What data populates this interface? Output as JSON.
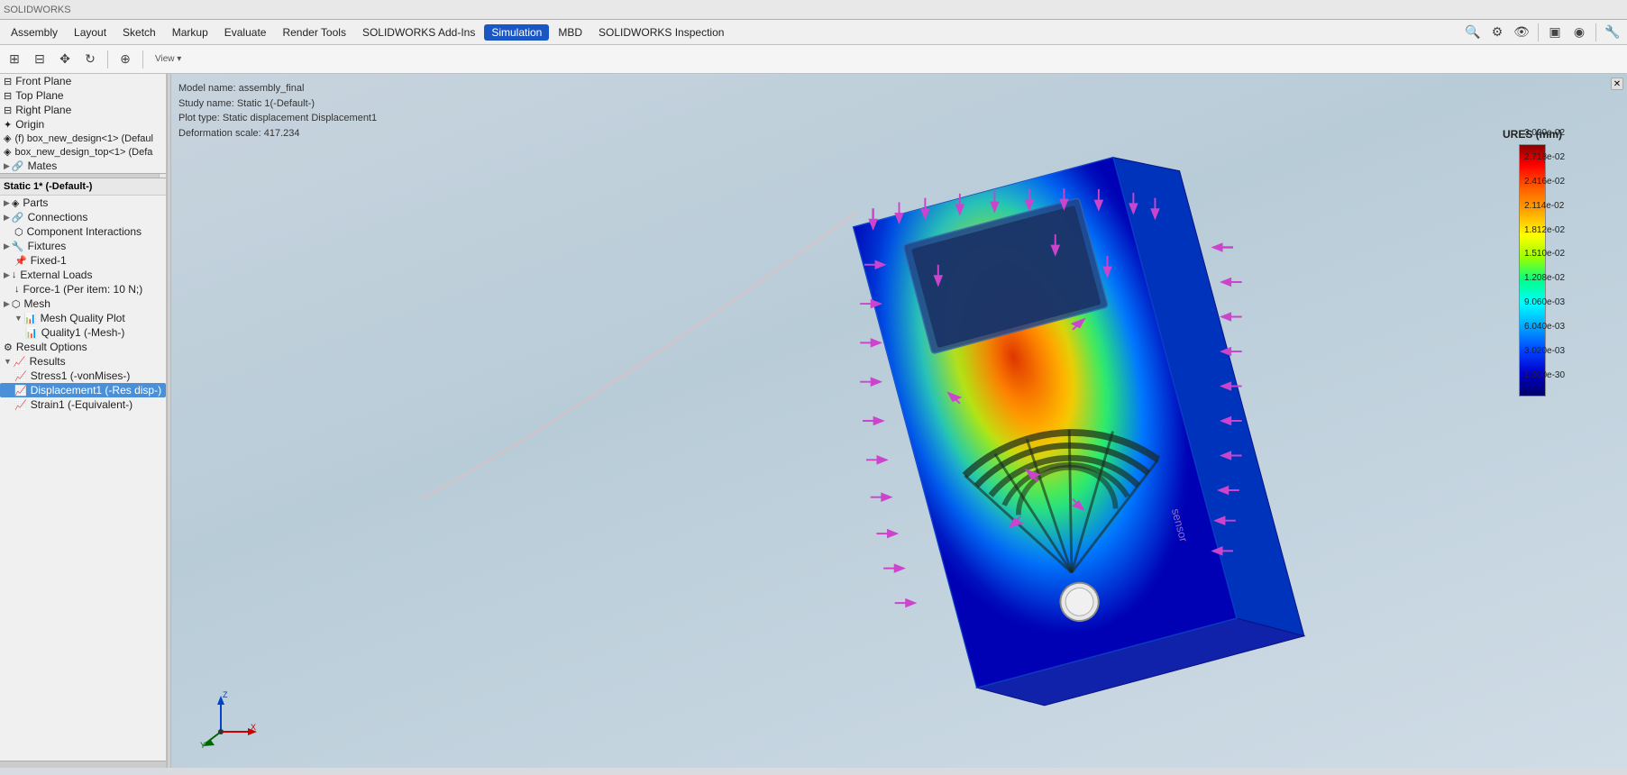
{
  "window": {
    "title": "SOLIDWORKS"
  },
  "toolbar": {
    "tab_assembly": "Assembly",
    "tab_layout": "Layout",
    "tab_sketch": "Sketch",
    "tab_markup": "Markup",
    "tab_evaluate": "Evaluate",
    "tab_render_tools": "Render Tools",
    "tab_solidworks_addins": "SOLIDWORKS Add-Ins",
    "tab_simulation": "Simulation",
    "tab_mbd": "MBD",
    "tab_solidworks_inspection": "SOLIDWORKS Inspection"
  },
  "model_info": {
    "model_name_label": "Model name: assembly_final",
    "study_name_label": "Study name: Static 1(-Default-)",
    "plot_type_label": "Plot type: Static displacement Displacement1",
    "deformation_scale_label": "Deformation scale: 417.234"
  },
  "tree": {
    "items": [
      {
        "id": "front-plane",
        "label": "Front Plane",
        "indent": 0,
        "icon": "⊟",
        "expand": ""
      },
      {
        "id": "top-plane",
        "label": "Top Plane",
        "indent": 0,
        "icon": "⊟",
        "expand": ""
      },
      {
        "id": "right-plane",
        "label": "Right Plane",
        "indent": 0,
        "icon": "⊟",
        "expand": ""
      },
      {
        "id": "origin",
        "label": "Origin",
        "indent": 0,
        "icon": "✦",
        "expand": ""
      },
      {
        "id": "box-new-design",
        "label": "(f) box_new_design<1> (Defaul",
        "indent": 0,
        "icon": "◈",
        "expand": ""
      },
      {
        "id": "box-new-design-top",
        "label": "box_new_design_top<1> (Defa",
        "indent": 0,
        "icon": "◈",
        "expand": ""
      },
      {
        "id": "mates",
        "label": "Mates",
        "indent": 0,
        "icon": "🔗",
        "expand": "▶"
      }
    ]
  },
  "simulation_tree": {
    "study_label": "Static 1* (-Default-)",
    "items": [
      {
        "id": "parts",
        "label": "Parts",
        "indent": 0,
        "icon": "◈",
        "expand": "▶"
      },
      {
        "id": "connections",
        "label": "Connections",
        "indent": 0,
        "icon": "🔗",
        "expand": "▶"
      },
      {
        "id": "component-interactions",
        "label": "Component Interactions",
        "indent": 1,
        "icon": "⬡",
        "expand": ""
      },
      {
        "id": "fixtures",
        "label": "Fixtures",
        "indent": 0,
        "icon": "🔧",
        "expand": "▶"
      },
      {
        "id": "fixed-1",
        "label": "Fixed-1",
        "indent": 1,
        "icon": "📌",
        "expand": ""
      },
      {
        "id": "external-loads",
        "label": "External Loads",
        "indent": 0,
        "icon": "↓",
        "expand": "▶"
      },
      {
        "id": "force-1",
        "label": "Force-1 (Per item: 10 N;)",
        "indent": 1,
        "icon": "↓",
        "expand": ""
      },
      {
        "id": "mesh",
        "label": "Mesh",
        "indent": 0,
        "icon": "⬡",
        "expand": "▶"
      },
      {
        "id": "mesh-quality-plot",
        "label": "Mesh Quality Plot",
        "indent": 1,
        "icon": "📊",
        "expand": "▶"
      },
      {
        "id": "quality1",
        "label": "Quality1 (-Mesh-)",
        "indent": 2,
        "icon": "📊",
        "expand": ""
      },
      {
        "id": "result-options",
        "label": "Result Options",
        "indent": 0,
        "icon": "⚙",
        "expand": ""
      },
      {
        "id": "results",
        "label": "Results",
        "indent": 0,
        "icon": "📈",
        "expand": "▶"
      },
      {
        "id": "stress1",
        "label": "Stress1 (-vonMises-)",
        "indent": 1,
        "icon": "📈",
        "expand": ""
      },
      {
        "id": "displacement1",
        "label": "Displacement1 (-Res disp-)",
        "indent": 1,
        "icon": "📈",
        "expand": "",
        "selected": true
      },
      {
        "id": "strain1",
        "label": "Strain1 (-Equivalent-)",
        "indent": 1,
        "icon": "📈",
        "expand": ""
      }
    ]
  },
  "legend": {
    "title": "URES (mm)",
    "values": [
      "3.020e-02",
      "2.718e-02",
      "2.416e-02",
      "2.114e-02",
      "1.812e-02",
      "1.510e-02",
      "1.208e-02",
      "9.060e-03",
      "6.040e-03",
      "3.020e-03",
      "1.000e-30"
    ]
  },
  "icons": {
    "expand": "▶",
    "collapse": "▼",
    "close": "✕",
    "chevron_right": "›",
    "chevron_down": "▾"
  }
}
